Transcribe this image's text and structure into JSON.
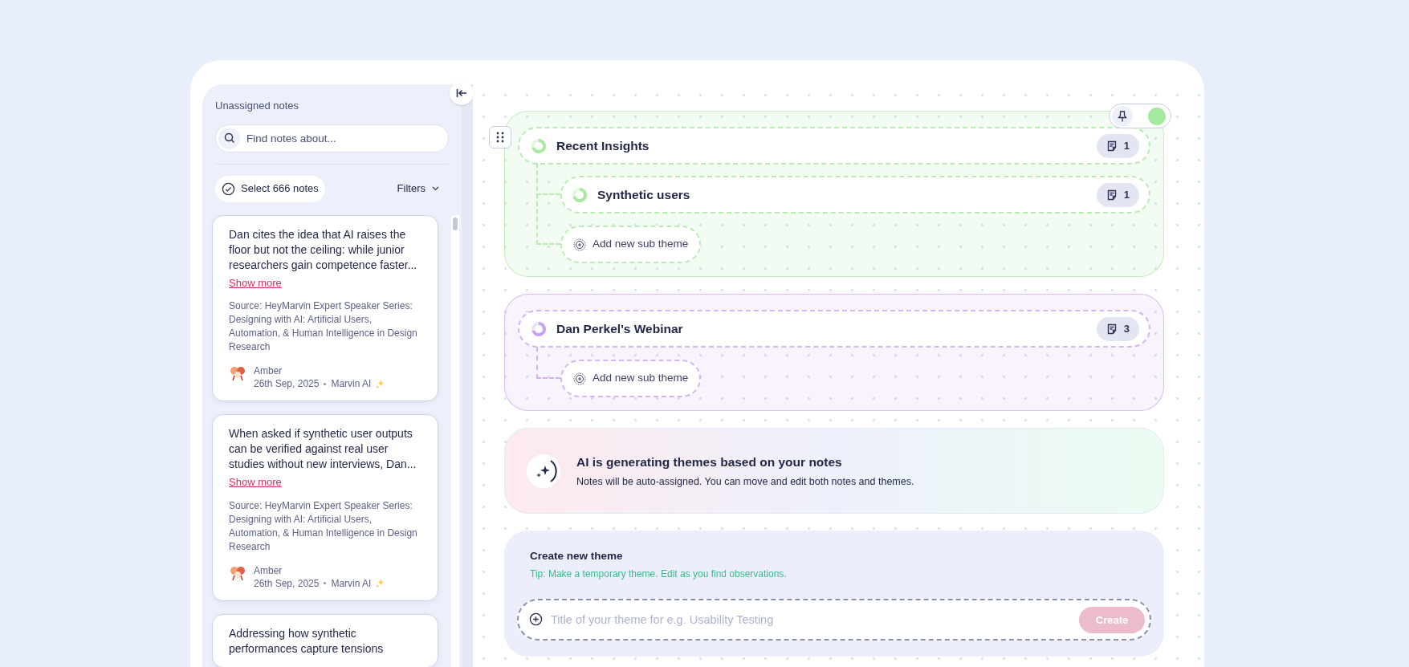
{
  "sidebar": {
    "title": "Unassigned notes",
    "search": {
      "placeholder": "Find notes about..."
    },
    "select_button": "Select 666 notes",
    "filters": "Filters",
    "notes": [
      {
        "text": "Dan cites the idea that AI raises the floor but not the ceiling: while junior researchers gain competence faster...",
        "link": "Show more",
        "source": "Source: HeyMarvin Expert Speaker Series: Designing with AI: Artificial Users, Automation, & Human Intelligence in Design Research",
        "author": "Amber",
        "date": "26th Sep, 2025",
        "origin": "Marvin AI"
      },
      {
        "text": "When asked if synthetic user outputs can be verified against real user studies without new interviews, Dan...",
        "link": "Show more",
        "source": "Source: HeyMarvin Expert Speaker Series: Designing with AI: Artificial Users, Automation, & Human Intelligence in Design Research",
        "author": "Amber",
        "date": "26th Sep, 2025",
        "origin": "Marvin AI"
      },
      {
        "text": "Addressing how synthetic performances capture tensions"
      }
    ]
  },
  "themes": [
    {
      "title": "Recent Insights",
      "count": "1",
      "color": "#a6e9a0",
      "hovered": true,
      "children": [
        {
          "title": "Synthetic users",
          "count": "1"
        }
      ],
      "add_label": "Add new sub theme"
    },
    {
      "title": "Dan Perkel's Webinar",
      "count": "3",
      "color": "#c7a3f0",
      "hovered": false,
      "add_label": "Add new sub theme"
    }
  ],
  "ai_banner": {
    "title": "AI is generating themes based on your notes",
    "text": "Notes will be auto-assigned. You can move and edit both notes and themes."
  },
  "create_theme": {
    "title": "Create new theme",
    "tip": "Tip: Make a temporary theme. Edit as you find observations.",
    "placeholder": "Title of your theme for e.g. Usability Testing",
    "button": "Create"
  }
}
